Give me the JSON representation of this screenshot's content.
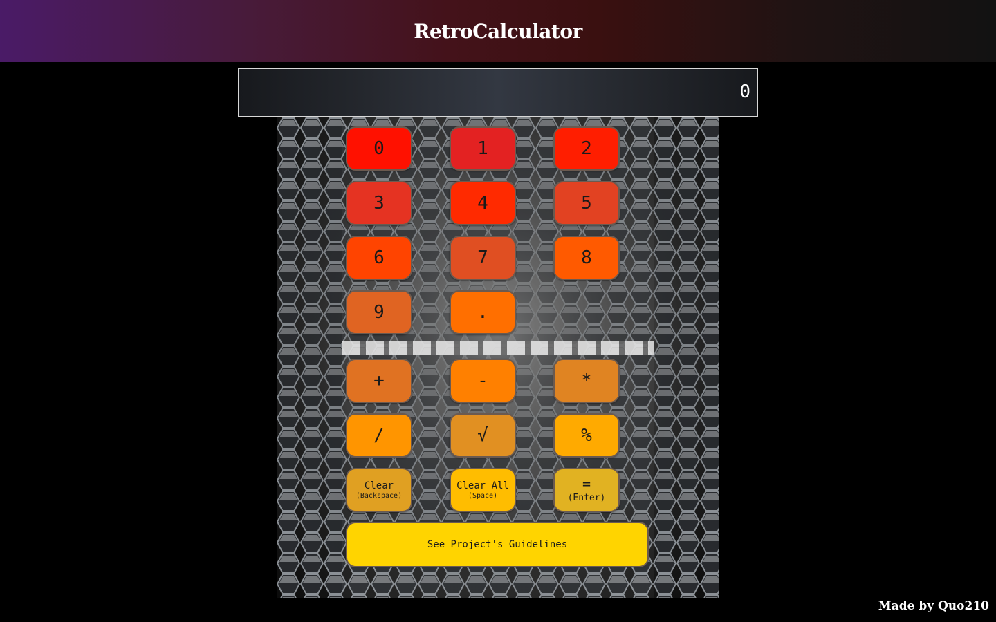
{
  "header": {
    "title": "RetroCalculator"
  },
  "display": {
    "value": "0"
  },
  "keys": {
    "k0": {
      "label": "0",
      "color": "#ff1100"
    },
    "k1": {
      "label": "1",
      "color": "#e32222"
    },
    "k2": {
      "label": "2",
      "color": "#ff1e00"
    },
    "k3": {
      "label": "3",
      "color": "#e53322"
    },
    "k4": {
      "label": "4",
      "color": "#ff2a00"
    },
    "k5": {
      "label": "5",
      "color": "#e24222"
    },
    "k6": {
      "label": "6",
      "color": "#ff4400"
    },
    "k7": {
      "label": "7",
      "color": "#e04f22"
    },
    "k8": {
      "label": "8",
      "color": "#ff5a00"
    },
    "k9": {
      "label": "9",
      "color": "#e06422"
    },
    "dot": {
      "label": ".",
      "color": "#ff6f00"
    },
    "add": {
      "label": "+",
      "color": "#e07222"
    },
    "sub": {
      "label": "-",
      "color": "#ff8000"
    },
    "mul": {
      "label": "*",
      "color": "#e08422"
    },
    "div": {
      "label": "/",
      "color": "#ff9500"
    },
    "sqrt": {
      "label": "√",
      "color": "#e19022"
    },
    "pct": {
      "label": "%",
      "color": "#ffaa00"
    },
    "clear": {
      "label": "Clear",
      "sub": "(Backspace)",
      "color": "#e0a022"
    },
    "clear_all": {
      "label": "Clear All",
      "sub": "(Space)",
      "color": "#ffbd00"
    },
    "equals": {
      "label": "=",
      "sub": "(Enter)",
      "color": "#e1b222"
    }
  },
  "guidelines_button": {
    "label": "See Project's Guidelines",
    "color": "#ffd400"
  },
  "footer": {
    "credit": "Made by Quo210"
  }
}
